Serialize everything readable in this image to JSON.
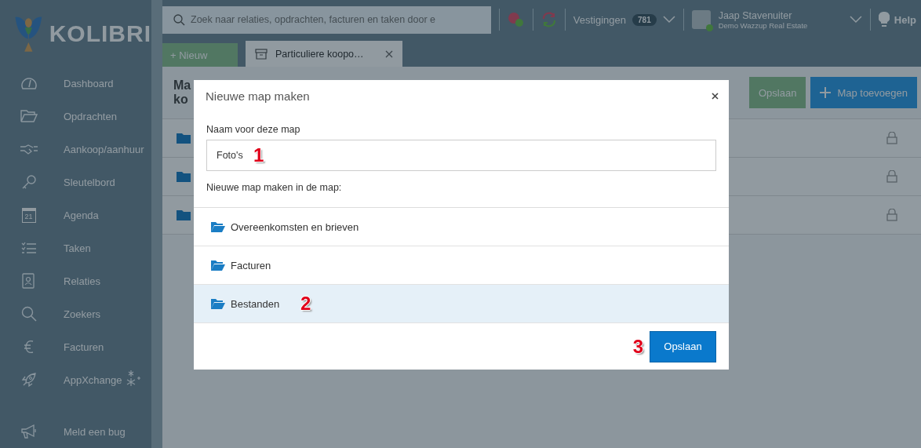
{
  "brand": {
    "name": "KOLIBRI"
  },
  "search": {
    "placeholder": "Zoek naar relaties, opdrachten, facturen en taken door e"
  },
  "topbar": {
    "branches_label": "Vestigingen",
    "branches_count": "781",
    "user_name": "Jaap Stavenuiter",
    "user_company": "Demo Wazzup Real Estate",
    "help": "Help"
  },
  "sidebar": {
    "items": [
      {
        "label": "Dashboard"
      },
      {
        "label": "Opdrachten"
      },
      {
        "label": "Aankoop/aanhuur"
      },
      {
        "label": "Sleutelbord"
      },
      {
        "label": "Agenda",
        "icon_text": "21"
      },
      {
        "label": "Taken"
      },
      {
        "label": "Relaties"
      },
      {
        "label": "Zoekers"
      },
      {
        "label": "Facturen"
      },
      {
        "label": "AppXchange"
      }
    ],
    "bottom_item": {
      "label": "Meld een bug"
    }
  },
  "new_button": "+ Nieuw",
  "tabs": [
    {
      "label": "Particuliere koopo…",
      "selected": true
    }
  ],
  "page": {
    "title_lines": [
      "Ma",
      "ko"
    ],
    "buttons": [
      "Opslaan",
      "Map toevoegen"
    ]
  },
  "modal": {
    "title": "Nieuwe map maken",
    "name_label": "Naam voor deze map",
    "name_value": "Foto's",
    "parent_label": "Nieuwe map maken in de map:",
    "folders": [
      {
        "label": "Overeenkomsten en brieven",
        "selected": false
      },
      {
        "label": "Facturen",
        "selected": false
      },
      {
        "label": "Bestanden",
        "selected": true
      }
    ],
    "save_button": "Opslaan"
  },
  "annotations": [
    "1",
    "2",
    "3"
  ]
}
